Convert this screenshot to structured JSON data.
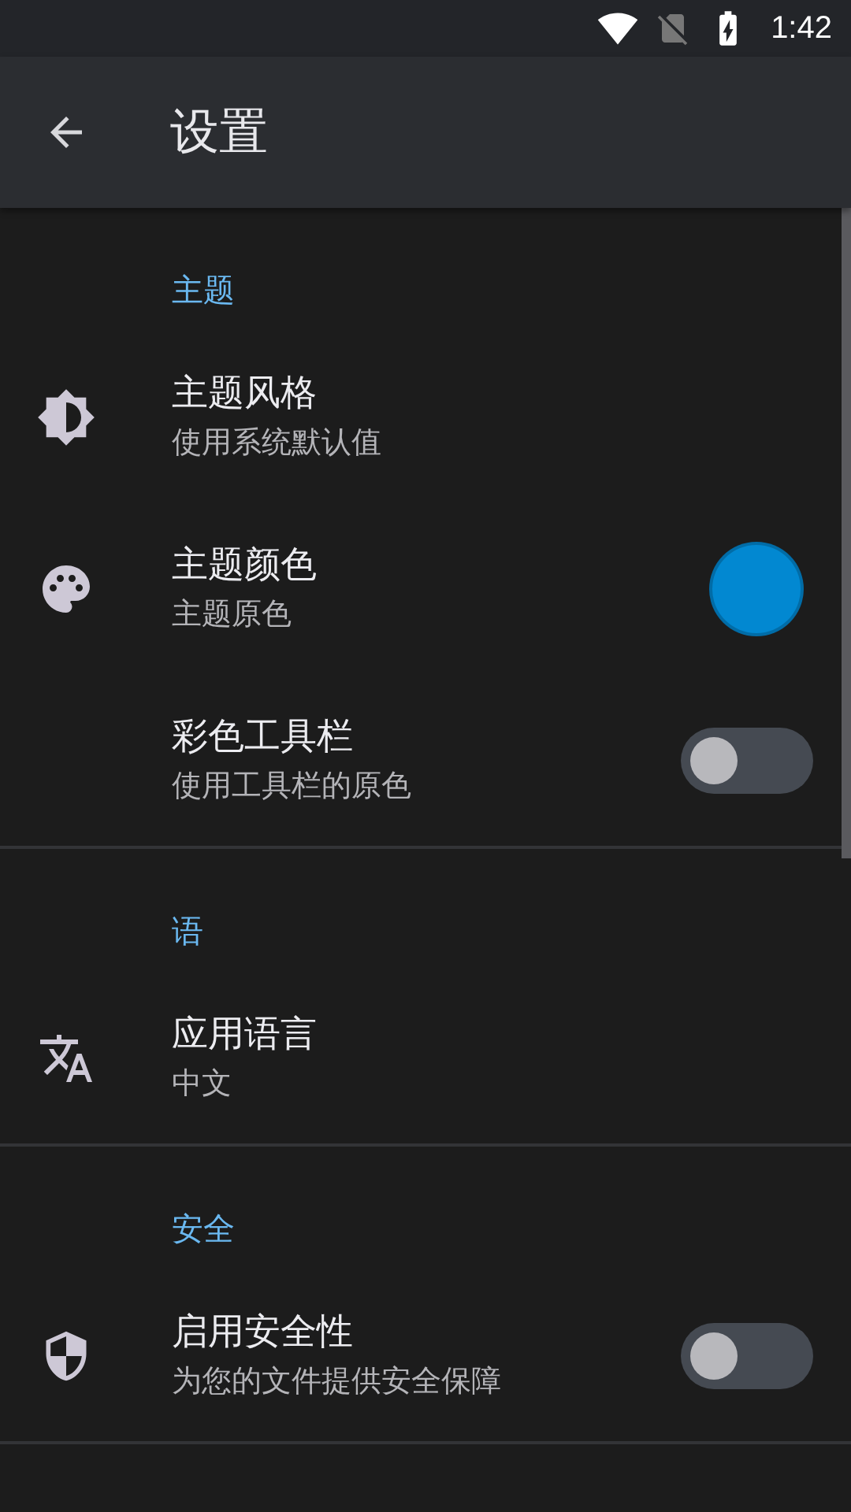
{
  "status_bar": {
    "time": "1:42"
  },
  "toolbar": {
    "title": "设置"
  },
  "sections": [
    {
      "header": "主题",
      "items": [
        {
          "kind": "link",
          "title": "主题风格",
          "subtitle": "使用系统默认值"
        },
        {
          "kind": "color",
          "title": "主题颜色",
          "subtitle": "主题原色",
          "color": "#0288d1"
        },
        {
          "kind": "toggle",
          "title": "彩色工具栏",
          "subtitle": "使用工具栏的原色",
          "on": false
        }
      ]
    },
    {
      "header": "语",
      "items": [
        {
          "kind": "link",
          "title": "应用语言",
          "subtitle": "中文"
        }
      ]
    },
    {
      "header": "安全",
      "items": [
        {
          "kind": "toggle",
          "title": "启用安全性",
          "subtitle": "为您的文件提供安全保障",
          "on": false
        }
      ]
    }
  ]
}
